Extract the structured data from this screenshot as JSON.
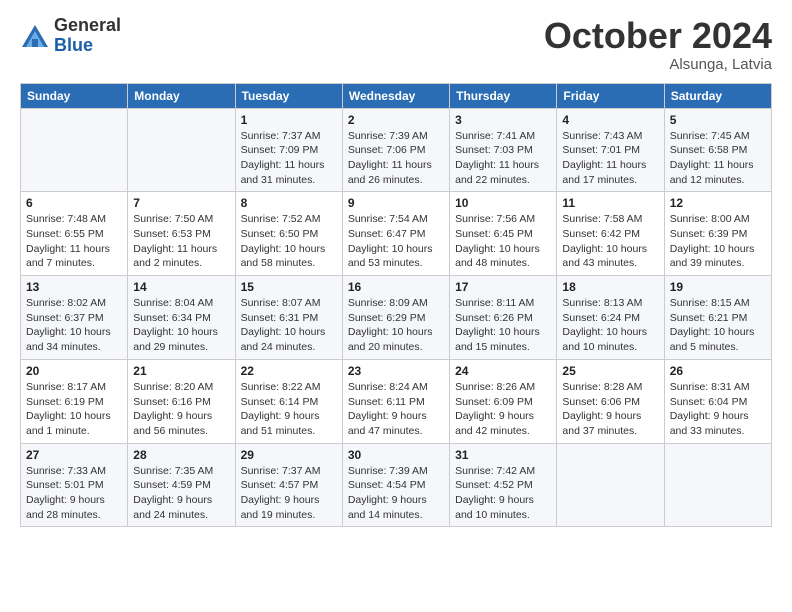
{
  "logo": {
    "general": "General",
    "blue": "Blue"
  },
  "header": {
    "month": "October 2024",
    "location": "Alsunga, Latvia"
  },
  "weekdays": [
    "Sunday",
    "Monday",
    "Tuesday",
    "Wednesday",
    "Thursday",
    "Friday",
    "Saturday"
  ],
  "weeks": [
    [
      {
        "day": "",
        "info": ""
      },
      {
        "day": "",
        "info": ""
      },
      {
        "day": "1",
        "info": "Sunrise: 7:37 AM\nSunset: 7:09 PM\nDaylight: 11 hours and 31 minutes."
      },
      {
        "day": "2",
        "info": "Sunrise: 7:39 AM\nSunset: 7:06 PM\nDaylight: 11 hours and 26 minutes."
      },
      {
        "day": "3",
        "info": "Sunrise: 7:41 AM\nSunset: 7:03 PM\nDaylight: 11 hours and 22 minutes."
      },
      {
        "day": "4",
        "info": "Sunrise: 7:43 AM\nSunset: 7:01 PM\nDaylight: 11 hours and 17 minutes."
      },
      {
        "day": "5",
        "info": "Sunrise: 7:45 AM\nSunset: 6:58 PM\nDaylight: 11 hours and 12 minutes."
      }
    ],
    [
      {
        "day": "6",
        "info": "Sunrise: 7:48 AM\nSunset: 6:55 PM\nDaylight: 11 hours and 7 minutes."
      },
      {
        "day": "7",
        "info": "Sunrise: 7:50 AM\nSunset: 6:53 PM\nDaylight: 11 hours and 2 minutes."
      },
      {
        "day": "8",
        "info": "Sunrise: 7:52 AM\nSunset: 6:50 PM\nDaylight: 10 hours and 58 minutes."
      },
      {
        "day": "9",
        "info": "Sunrise: 7:54 AM\nSunset: 6:47 PM\nDaylight: 10 hours and 53 minutes."
      },
      {
        "day": "10",
        "info": "Sunrise: 7:56 AM\nSunset: 6:45 PM\nDaylight: 10 hours and 48 minutes."
      },
      {
        "day": "11",
        "info": "Sunrise: 7:58 AM\nSunset: 6:42 PM\nDaylight: 10 hours and 43 minutes."
      },
      {
        "day": "12",
        "info": "Sunrise: 8:00 AM\nSunset: 6:39 PM\nDaylight: 10 hours and 39 minutes."
      }
    ],
    [
      {
        "day": "13",
        "info": "Sunrise: 8:02 AM\nSunset: 6:37 PM\nDaylight: 10 hours and 34 minutes."
      },
      {
        "day": "14",
        "info": "Sunrise: 8:04 AM\nSunset: 6:34 PM\nDaylight: 10 hours and 29 minutes."
      },
      {
        "day": "15",
        "info": "Sunrise: 8:07 AM\nSunset: 6:31 PM\nDaylight: 10 hours and 24 minutes."
      },
      {
        "day": "16",
        "info": "Sunrise: 8:09 AM\nSunset: 6:29 PM\nDaylight: 10 hours and 20 minutes."
      },
      {
        "day": "17",
        "info": "Sunrise: 8:11 AM\nSunset: 6:26 PM\nDaylight: 10 hours and 15 minutes."
      },
      {
        "day": "18",
        "info": "Sunrise: 8:13 AM\nSunset: 6:24 PM\nDaylight: 10 hours and 10 minutes."
      },
      {
        "day": "19",
        "info": "Sunrise: 8:15 AM\nSunset: 6:21 PM\nDaylight: 10 hours and 5 minutes."
      }
    ],
    [
      {
        "day": "20",
        "info": "Sunrise: 8:17 AM\nSunset: 6:19 PM\nDaylight: 10 hours and 1 minute."
      },
      {
        "day": "21",
        "info": "Sunrise: 8:20 AM\nSunset: 6:16 PM\nDaylight: 9 hours and 56 minutes."
      },
      {
        "day": "22",
        "info": "Sunrise: 8:22 AM\nSunset: 6:14 PM\nDaylight: 9 hours and 51 minutes."
      },
      {
        "day": "23",
        "info": "Sunrise: 8:24 AM\nSunset: 6:11 PM\nDaylight: 9 hours and 47 minutes."
      },
      {
        "day": "24",
        "info": "Sunrise: 8:26 AM\nSunset: 6:09 PM\nDaylight: 9 hours and 42 minutes."
      },
      {
        "day": "25",
        "info": "Sunrise: 8:28 AM\nSunset: 6:06 PM\nDaylight: 9 hours and 37 minutes."
      },
      {
        "day": "26",
        "info": "Sunrise: 8:31 AM\nSunset: 6:04 PM\nDaylight: 9 hours and 33 minutes."
      }
    ],
    [
      {
        "day": "27",
        "info": "Sunrise: 7:33 AM\nSunset: 5:01 PM\nDaylight: 9 hours and 28 minutes."
      },
      {
        "day": "28",
        "info": "Sunrise: 7:35 AM\nSunset: 4:59 PM\nDaylight: 9 hours and 24 minutes."
      },
      {
        "day": "29",
        "info": "Sunrise: 7:37 AM\nSunset: 4:57 PM\nDaylight: 9 hours and 19 minutes."
      },
      {
        "day": "30",
        "info": "Sunrise: 7:39 AM\nSunset: 4:54 PM\nDaylight: 9 hours and 14 minutes."
      },
      {
        "day": "31",
        "info": "Sunrise: 7:42 AM\nSunset: 4:52 PM\nDaylight: 9 hours and 10 minutes."
      },
      {
        "day": "",
        "info": ""
      },
      {
        "day": "",
        "info": ""
      }
    ]
  ]
}
